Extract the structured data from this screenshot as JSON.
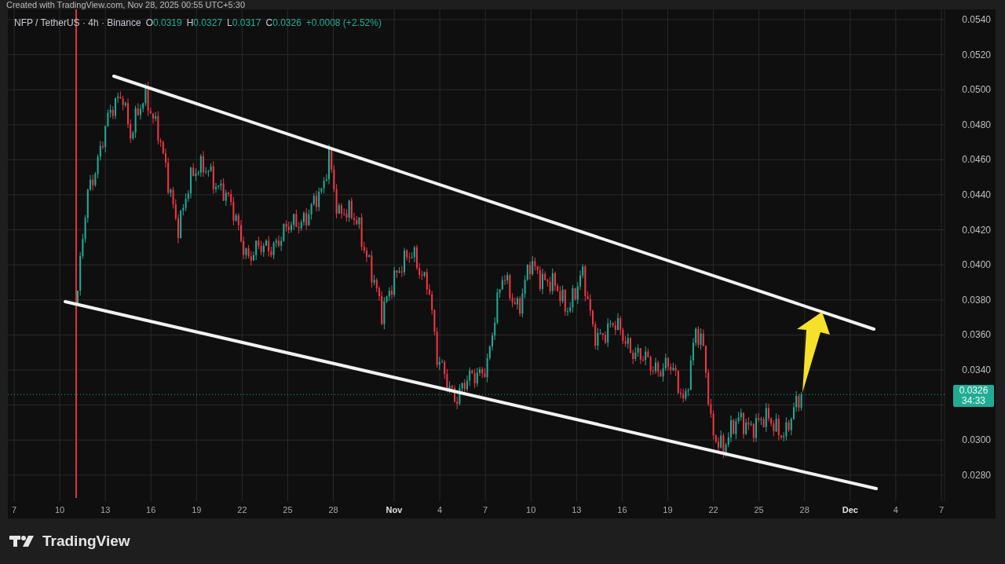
{
  "caption": "Created with TradingView.com, Nov 28, 2025 00:55 UTC+5:30",
  "legend": {
    "title": "NFP / TetherUS · 4h · Binance",
    "fields": [
      {
        "label": "O",
        "value": "0.0319"
      },
      {
        "label": "H",
        "value": "0.0327"
      },
      {
        "label": "L",
        "value": "0.0317"
      },
      {
        "label": "C",
        "value": "0.0326"
      }
    ],
    "change": "+0.0008 (+2.52%)"
  },
  "price_axis": {
    "ticks": [
      "0.0540",
      "0.0520",
      "0.0500",
      "0.0480",
      "0.0460",
      "0.0440",
      "0.0420",
      "0.0400",
      "0.0380",
      "0.0360",
      "0.0340",
      "0.0300",
      "0.0280"
    ]
  },
  "last_price": {
    "price": "0.0326",
    "countdown": "34:33"
  },
  "time_axis": {
    "ticks": [
      {
        "label": "7",
        "month": false
      },
      {
        "label": "10",
        "month": false
      },
      {
        "label": "13",
        "month": false
      },
      {
        "label": "16",
        "month": false
      },
      {
        "label": "19",
        "month": false
      },
      {
        "label": "22",
        "month": false
      },
      {
        "label": "25",
        "month": false
      },
      {
        "label": "28",
        "month": false
      },
      {
        "label": "Nov",
        "month": true
      },
      {
        "label": "4",
        "month": false
      },
      {
        "label": "7",
        "month": false
      },
      {
        "label": "10",
        "month": false
      },
      {
        "label": "13",
        "month": false
      },
      {
        "label": "16",
        "month": false
      },
      {
        "label": "19",
        "month": false
      },
      {
        "label": "22",
        "month": false
      },
      {
        "label": "25",
        "month": false
      },
      {
        "label": "28",
        "month": false
      },
      {
        "label": "Dec",
        "month": true
      },
      {
        "label": "4",
        "month": false
      },
      {
        "label": "7",
        "month": false
      }
    ]
  },
  "brand": {
    "name": "TradingView"
  }
}
